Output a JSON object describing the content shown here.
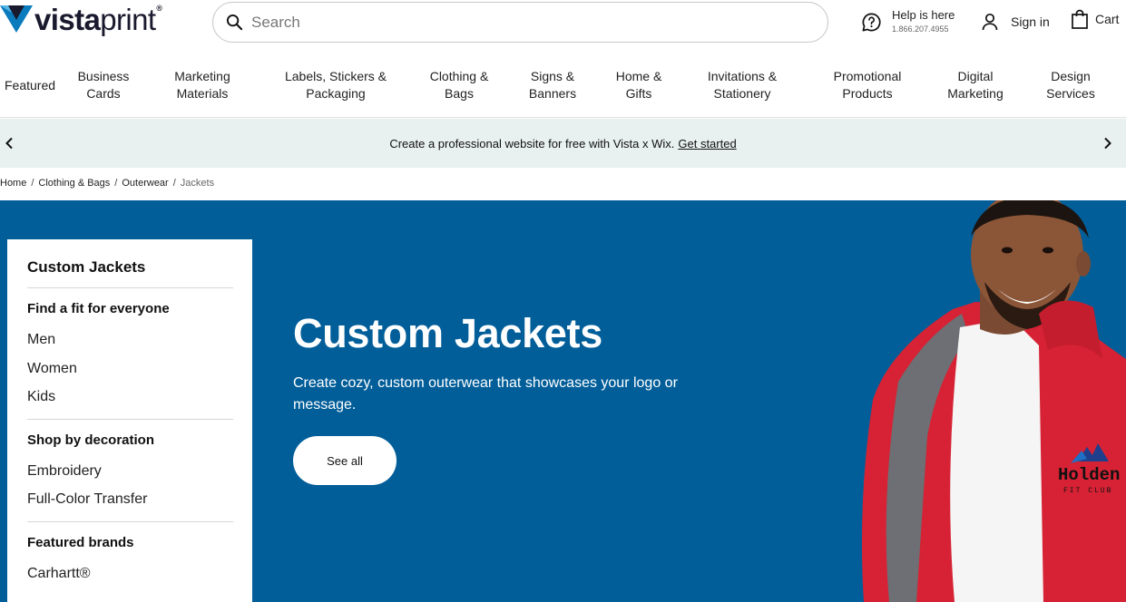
{
  "header": {
    "logo_bold": "vista",
    "logo_light": "print",
    "logo_reg": "®",
    "search_placeholder": "Search",
    "help_title": "Help is here",
    "help_phone": "1.866.207.4955",
    "signin_label": "Sign in",
    "cart_label": "Cart",
    "brand_color": "#1a1a2e",
    "logo_accent_color": "#0a7bbd"
  },
  "nav": {
    "items": [
      {
        "line1": "Featured",
        "line2": ""
      },
      {
        "line1": "Business",
        "line2": "Cards"
      },
      {
        "line1": "Marketing",
        "line2": "Materials"
      },
      {
        "line1": "Labels, Stickers &",
        "line2": "Packaging"
      },
      {
        "line1": "Clothing &",
        "line2": "Bags"
      },
      {
        "line1": "Signs &",
        "line2": "Banners"
      },
      {
        "line1": "Home &",
        "line2": "Gifts"
      },
      {
        "line1": "Invitations &",
        "line2": "Stationery"
      },
      {
        "line1": "Promotional",
        "line2": "Products"
      },
      {
        "line1": "Digital",
        "line2": "Marketing"
      },
      {
        "line1": "Design",
        "line2": "Services"
      }
    ]
  },
  "promo": {
    "text": "Create a professional website for free with Vista x Wix.",
    "link": "Get started",
    "background": "#e8f1ef"
  },
  "breadcrumb": {
    "items": [
      "Home",
      "Clothing & Bags",
      "Outerwear"
    ],
    "separator": "/",
    "current": "Jackets"
  },
  "hero": {
    "title": "Custom Jackets",
    "subtitle": "Create cozy, custom outerwear that showcases your logo or message.",
    "button_label": "See all",
    "background": "#025e99",
    "jacket_logo_text": "Holden",
    "jacket_logo_sub": "FIT CLUB"
  },
  "sidebar": {
    "title": "Custom Jackets",
    "sections": [
      {
        "title": "Find a fit for everyone",
        "items": [
          "Men",
          "Women",
          "Kids"
        ]
      },
      {
        "title": "Shop by decoration",
        "items": [
          "Embroidery",
          "Full-Color Transfer"
        ]
      },
      {
        "title": "Featured brands",
        "items": [
          "Carhartt®"
        ]
      }
    ]
  }
}
